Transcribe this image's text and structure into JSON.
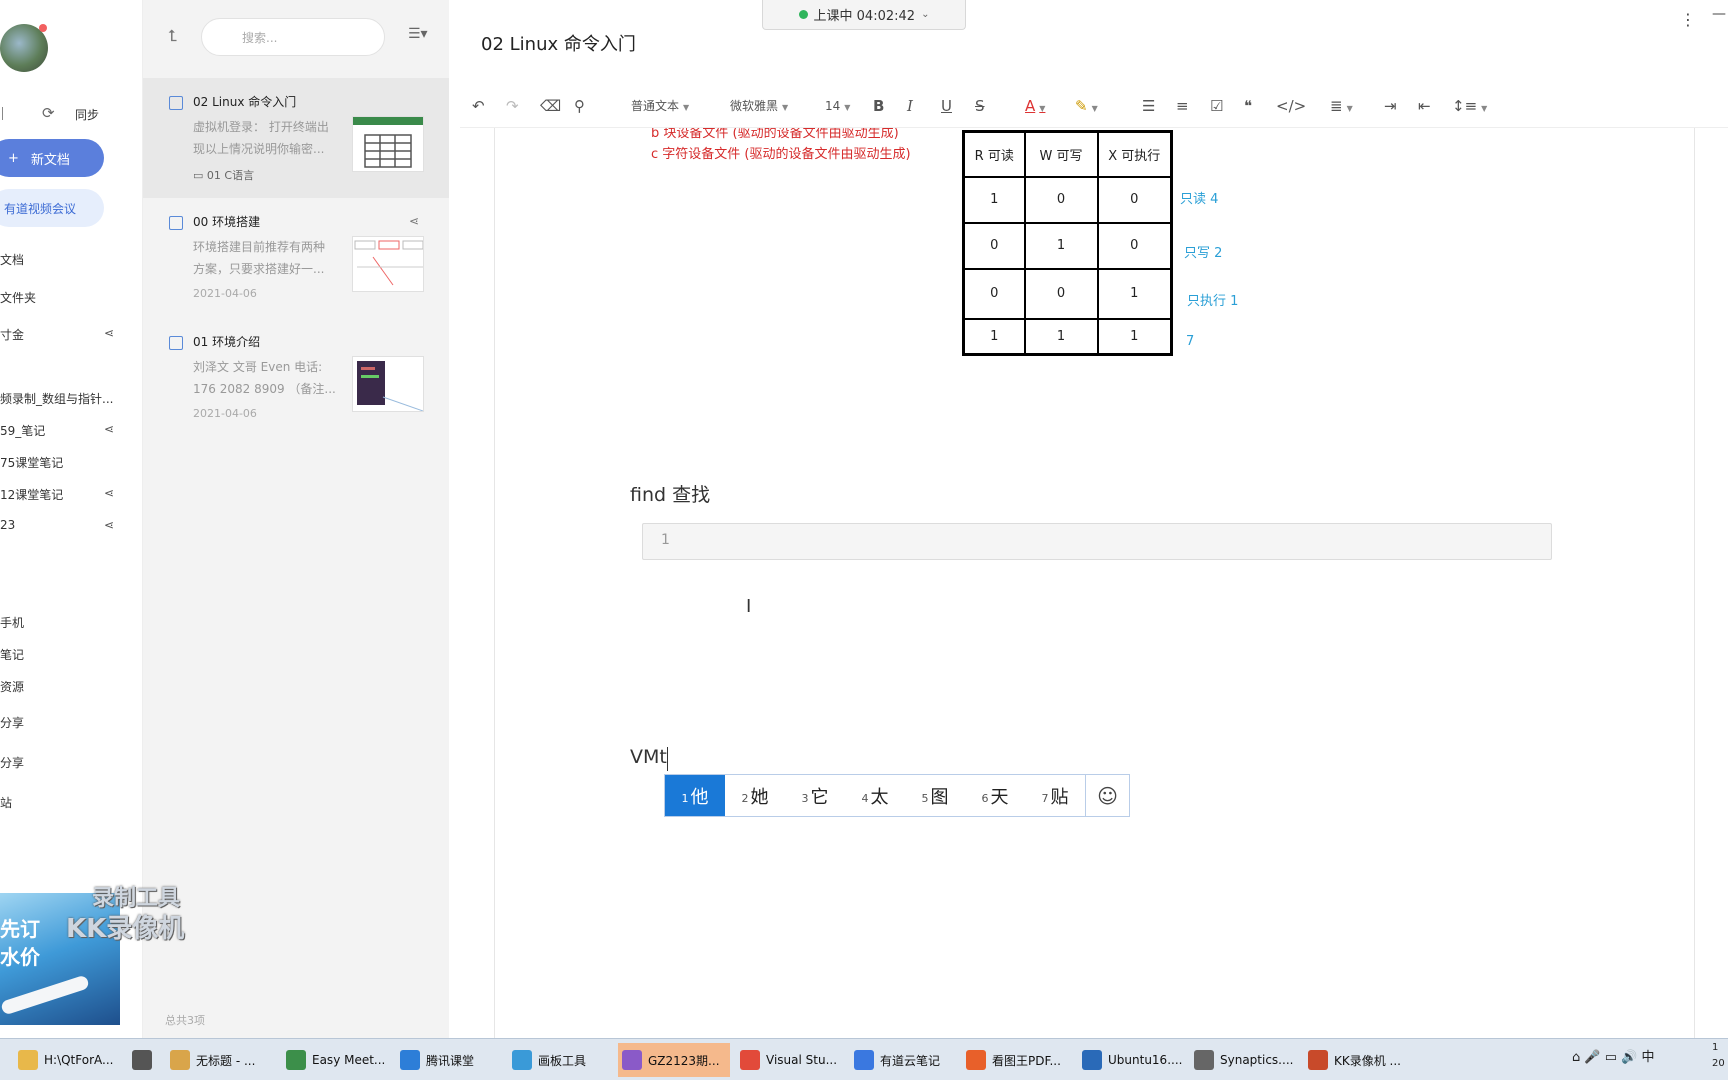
{
  "recording_status": {
    "label": "上课中 04:02:42"
  },
  "sidebar": {
    "sync_label": "同步",
    "new_doc_label": "新文档",
    "video_meeting_label": "有道视频会议",
    "items": [
      {
        "label": "文档"
      },
      {
        "label": "文件夹"
      },
      {
        "label": "寸金"
      },
      {
        "label": "频录制_数组与指针..."
      },
      {
        "label": "59_笔记"
      },
      {
        "label": "75课堂笔记"
      },
      {
        "label": "12课堂笔记"
      },
      {
        "label": "23"
      },
      {
        "label": "手机"
      },
      {
        "label": "笔记"
      },
      {
        "label": "资源"
      },
      {
        "label": "分享"
      },
      {
        "label": "分享"
      },
      {
        "label": "站"
      }
    ],
    "ad": {
      "line1": "先订",
      "line2": "水价"
    }
  },
  "watermark": {
    "line1": "录制工具",
    "line2": "KK录像机"
  },
  "notelist": {
    "search_placeholder": "搜索...",
    "notes": [
      {
        "title": "02 Linux 命令入门",
        "summary": "虚拟机登录： 打开终端出\n现以上情况说明你输密...",
        "folder": "01 C语言"
      },
      {
        "title": "00 环境搭建",
        "summary": "环境搭建目前推荐有两种\n方案，只要求搭建好一...",
        "date": "2021-04-06"
      },
      {
        "title": "01 环境介绍",
        "summary": "刘泽文 文哥 Even 电话:\n176 2082 8909 （备注...",
        "date": "2021-04-06"
      }
    ],
    "total": "总共3项"
  },
  "editor": {
    "doc_title": "02 Linux 命令入门",
    "toolbar": {
      "paragraph": "普通文本",
      "font": "微软雅黑",
      "size": "14"
    },
    "red_lines": [
      "b  块设备文件  (驱动的设备文件由驱动生成)",
      "c  字符设备文件  (驱动的设备文件由驱动生成)"
    ],
    "table": {
      "headers": [
        "R 可读",
        "W  可写",
        "X 可执行"
      ],
      "rows": [
        [
          "1",
          "0",
          "0"
        ],
        [
          "0",
          "1",
          "0"
        ],
        [
          "0",
          "0",
          "1"
        ],
        [
          "1",
          "1",
          "1"
        ]
      ],
      "row_labels": [
        "只读 4",
        "只写  2",
        "只执行  1",
        "7"
      ]
    },
    "find_heading": "find   查找",
    "code_line_number": "1",
    "typing_text": "VMt"
  },
  "ime": {
    "candidates": [
      {
        "n": "1",
        "c": "他"
      },
      {
        "n": "2",
        "c": "她"
      },
      {
        "n": "3",
        "c": "它"
      },
      {
        "n": "4",
        "c": "太"
      },
      {
        "n": "5",
        "c": "图"
      },
      {
        "n": "6",
        "c": "天"
      },
      {
        "n": "7",
        "c": "贴"
      }
    ]
  },
  "taskbar": {
    "items": [
      {
        "label": "H:\\QtForA...",
        "color": "#e8b84a"
      },
      {
        "label": "",
        "color": "#555555"
      },
      {
        "label": "无标题 - ...",
        "color": "#d9a54a"
      },
      {
        "label": "Easy Meet...",
        "color": "#3c8f4a"
      },
      {
        "label": "腾讯课堂",
        "color": "#2d7ed8"
      },
      {
        "label": "画板工具",
        "color": "#3a9ad8"
      },
      {
        "label": "GZ2123期...",
        "color": "#8a5ac8"
      },
      {
        "label": "Visual Stu...",
        "color": "#e24a3a"
      },
      {
        "label": "有道云笔记",
        "color": "#3a78e0"
      },
      {
        "label": "看图王PDF...",
        "color": "#e8602a"
      },
      {
        "label": "Ubuntu16....",
        "color": "#2a6ab8"
      },
      {
        "label": "Synaptics....",
        "color": "#666666"
      },
      {
        "label": "KK录像机 ...",
        "color": "#c84a2a"
      }
    ],
    "tray_lang": "中",
    "clock_line1": "1",
    "clock_line2": "20"
  }
}
